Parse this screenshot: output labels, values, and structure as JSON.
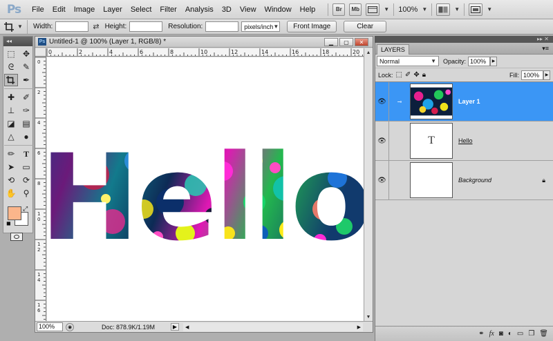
{
  "app": {
    "logo": "Ps",
    "menu": [
      "File",
      "Edit",
      "Image",
      "Layer",
      "Select",
      "Filter",
      "Analysis",
      "3D",
      "View",
      "Window",
      "Help"
    ],
    "bridge_label": "Br",
    "minibridge_label": "Mb",
    "zoom": "100%"
  },
  "options": {
    "width_label": "Width:",
    "height_label": "Height:",
    "resolution_label": "Resolution:",
    "width_value": "",
    "height_value": "",
    "resolution_value": "",
    "res_unit": "pixels/inch",
    "front_image": "Front Image",
    "clear": "Clear"
  },
  "document": {
    "title": "Untitled-1 @ 100% (Layer 1, RGB/8) *",
    "ruler_h": [
      "0",
      "2",
      "4",
      "6",
      "8",
      "10",
      "12",
      "14",
      "16",
      "18",
      "20"
    ],
    "ruler_v": [
      "0",
      "2",
      "4",
      "6",
      "8",
      "1\n0",
      "1\n2",
      "1\n4",
      "1\n6"
    ],
    "canvas_text": "Hello",
    "zoom": "100%",
    "doc_info": "Doc: 878.9K/1.19M"
  },
  "layers_panel": {
    "tab": "LAYERS",
    "blend_mode": "Normal",
    "opacity_label": "Opacity:",
    "opacity": "100%",
    "lock_label": "Lock:",
    "fill_label": "Fill:",
    "fill": "100%",
    "layers": [
      {
        "name": "Layer 1",
        "selected": true
      },
      {
        "name": "Hello",
        "thumb_text": "T"
      },
      {
        "name": "Background",
        "locked": true
      }
    ]
  },
  "colors": {
    "foreground": "#fbb68b",
    "background": "#ffffff",
    "selection": "#3b96f5"
  }
}
